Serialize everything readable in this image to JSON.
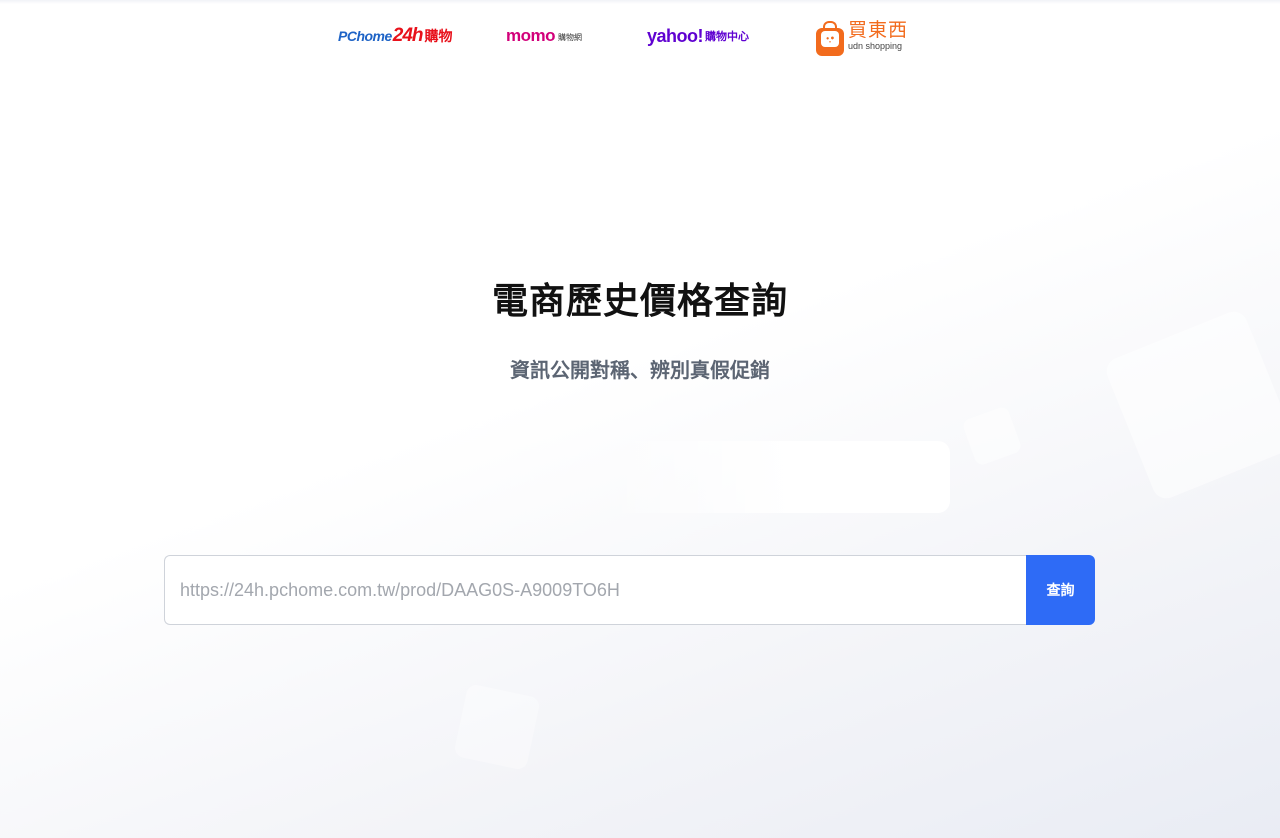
{
  "page": {
    "title": "電商歷史價格查詢",
    "subtitle": "資訊公開對稱、辨別真假促銷"
  },
  "stores": {
    "pchome": {
      "brand": "PChome",
      "brand_24h": "24h",
      "suffix": "購物"
    },
    "momo": {
      "brand": "momo",
      "suffix": "購物網"
    },
    "yahoo": {
      "brand": "yahoo!",
      "suffix": "購物中心"
    },
    "udn": {
      "name_cn": "買東西",
      "name_en": "udn shopping"
    }
  },
  "search": {
    "placeholder": "https://24h.pchome.com.tw/prod/DAAG0S-A9009TO6H",
    "value": "",
    "button_label": "查詢"
  },
  "colors": {
    "accent": "#2e6bf6",
    "pchome_blue": "#1e63c6",
    "pchome_red": "#e8111b",
    "momo_pink": "#d2007a",
    "yahoo_purple": "#5f01d1",
    "udn_orange": "#f26b1d"
  }
}
